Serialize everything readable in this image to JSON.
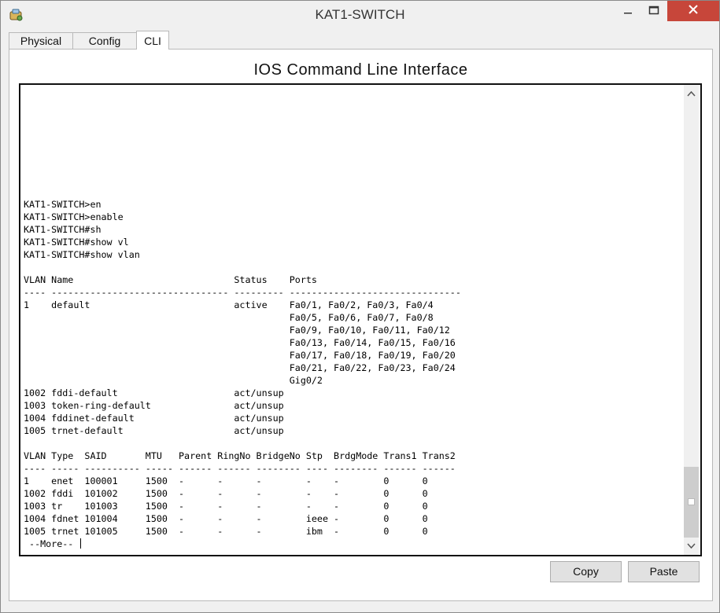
{
  "window": {
    "title": "KAT1-SWITCH",
    "controls": {
      "minimize": "minimize",
      "maximize": "maximize",
      "close": "close"
    }
  },
  "tabs": [
    {
      "label": "Physical",
      "active": false
    },
    {
      "label": "Config",
      "active": false
    },
    {
      "label": "CLI",
      "active": true
    }
  ],
  "cli": {
    "heading": "IOS Command Line Interface",
    "output": "KAT1-SWITCH>en\nKAT1-SWITCH>enable\nKAT1-SWITCH#sh\nKAT1-SWITCH#show vl\nKAT1-SWITCH#show vlan\n\nVLAN Name                             Status    Ports\n---- -------------------------------- --------- -------------------------------\n1    default                          active    Fa0/1, Fa0/2, Fa0/3, Fa0/4\n                                                Fa0/5, Fa0/6, Fa0/7, Fa0/8\n                                                Fa0/9, Fa0/10, Fa0/11, Fa0/12\n                                                Fa0/13, Fa0/14, Fa0/15, Fa0/16\n                                                Fa0/17, Fa0/18, Fa0/19, Fa0/20\n                                                Fa0/21, Fa0/22, Fa0/23, Fa0/24\n                                                Gig0/2\n1002 fddi-default                     act/unsup\n1003 token-ring-default               act/unsup\n1004 fddinet-default                  act/unsup\n1005 trnet-default                    act/unsup\n\nVLAN Type  SAID       MTU   Parent RingNo BridgeNo Stp  BrdgMode Trans1 Trans2\n---- ----- ---------- ----- ------ ------ -------- ---- -------- ------ ------\n1    enet  100001     1500  -      -      -        -    -        0      0\n1002 fddi  101002     1500  -      -      -        -    -        0      0\n1003 tr    101003     1500  -      -      -        -    -        0      0\n1004 fdnet 101004     1500  -      -      -        ieee -        0      0\n1005 trnet 101005     1500  -      -      -        ibm  -        0      0",
    "prompt_line": " --More-- "
  },
  "buttons": {
    "copy": "Copy",
    "paste": "Paste"
  },
  "colors": {
    "close_button": "#c7463a",
    "cli_border": "#111111",
    "background": "#f0f0f0"
  },
  "icons": [
    "app-icon",
    "minimize-icon",
    "maximize-icon",
    "close-icon",
    "scroll-up-icon",
    "scroll-down-icon"
  ]
}
